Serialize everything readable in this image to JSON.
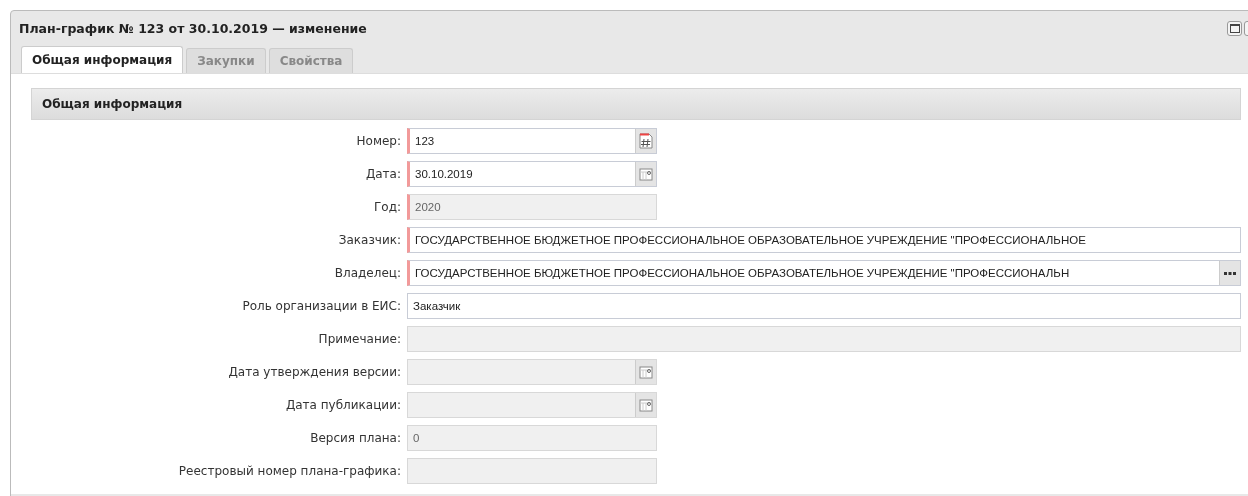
{
  "window": {
    "title": "План-график № 123 от 30.10.2019 — изменение"
  },
  "tabs": [
    {
      "label": "Общая информация",
      "selected": true
    },
    {
      "label": "Закупки",
      "selected": false
    },
    {
      "label": "Свойства",
      "selected": false
    }
  ],
  "panel": {
    "title": "Общая информация"
  },
  "fields": [
    {
      "label": "Номер:",
      "value": "123",
      "kind": "number",
      "required": true,
      "disabled": false
    },
    {
      "label": "Дата:",
      "value": "30.10.2019",
      "kind": "date",
      "required": true,
      "disabled": false
    },
    {
      "label": "Год:",
      "value": "2020",
      "kind": "text",
      "required": true,
      "disabled": true
    },
    {
      "label": "Заказчик:",
      "value": "ГОСУДАРСТВЕННОЕ БЮДЖЕТНОЕ ПРОФЕССИОНАЛЬНОЕ ОБРАЗОВАТЕЛЬНОЕ УЧРЕЖДЕНИЕ \"ПРОФЕССИОНАЛЬНОЕ",
      "kind": "wide",
      "required": true,
      "disabled": false
    },
    {
      "label": "Владелец:",
      "value": "ГОСУДАРСТВЕННОЕ БЮДЖЕТНОЕ ПРОФЕССИОНАЛЬНОЕ ОБРАЗОВАТЕЛЬНОЕ УЧРЕЖДЕНИЕ \"ПРОФЕССИОНАЛЬН",
      "kind": "lookup",
      "required": true,
      "disabled": false
    },
    {
      "label": "Роль организации в ЕИС:",
      "value": "Заказчик",
      "kind": "wide",
      "required": false,
      "disabled": false
    },
    {
      "label": "Примечание:",
      "kind": "wide",
      "required": false,
      "disabled": true
    },
    {
      "label": "Дата утверждения версии:",
      "kind": "date",
      "required": false,
      "disabled": true
    },
    {
      "label": "Дата публикации:",
      "kind": "date",
      "required": false,
      "disabled": true
    },
    {
      "label": "Версия плана:",
      "value": "0",
      "kind": "text",
      "required": false,
      "disabled": true
    },
    {
      "label": "Реестровый номер плана-графика:",
      "kind": "text",
      "required": false,
      "disabled": true
    }
  ]
}
